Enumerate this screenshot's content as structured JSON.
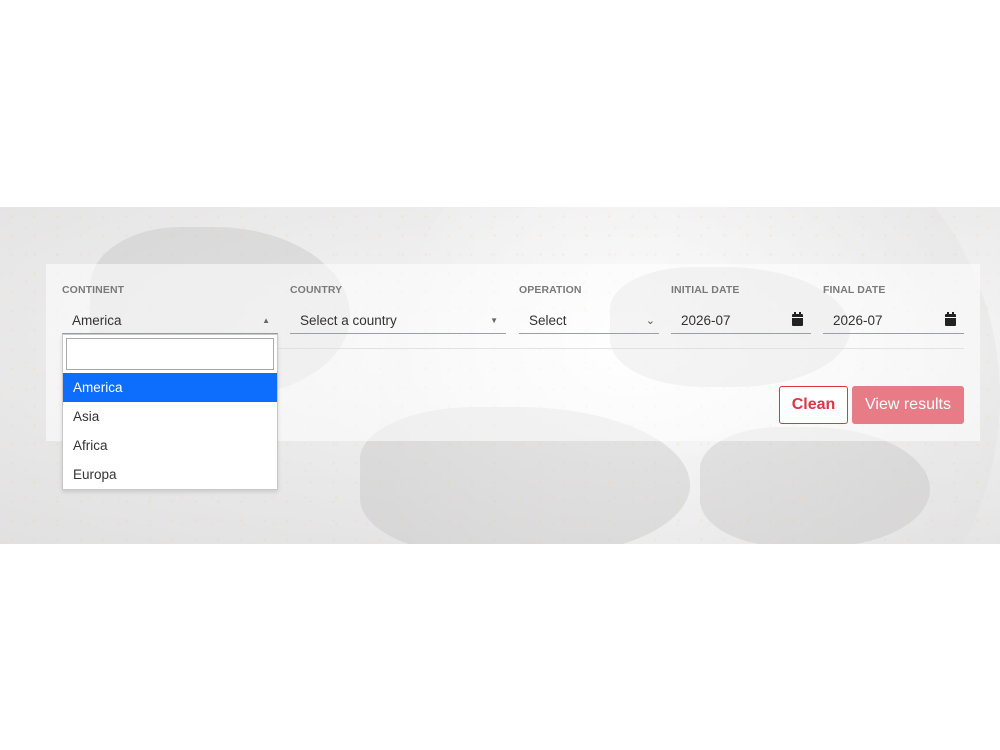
{
  "filters": {
    "continent": {
      "label": "CONTINENT",
      "value": "America",
      "options": [
        "America",
        "Asia",
        "Africa",
        "Europa"
      ],
      "selected_option": "America",
      "search_value": ""
    },
    "country": {
      "label": "COUNTRY",
      "value": "Select a country"
    },
    "operation": {
      "label": "OPERATION",
      "value": "Select"
    },
    "initial_date": {
      "label": "INITIAL DATE",
      "value": "2026-07"
    },
    "final_date": {
      "label": "FINAL DATE",
      "value": "2026-07"
    }
  },
  "actions": {
    "clean_label": "Clean",
    "view_results_label": "View results"
  },
  "colors": {
    "accent_blue": "#0d6efd",
    "danger": "#dc3545",
    "danger_muted": "#e77b86"
  },
  "icons": {
    "calendar": "calendar-icon",
    "caret_up": "caret-up-icon",
    "caret_down": "caret-down-icon",
    "chevron_down": "chevron-down-icon"
  }
}
